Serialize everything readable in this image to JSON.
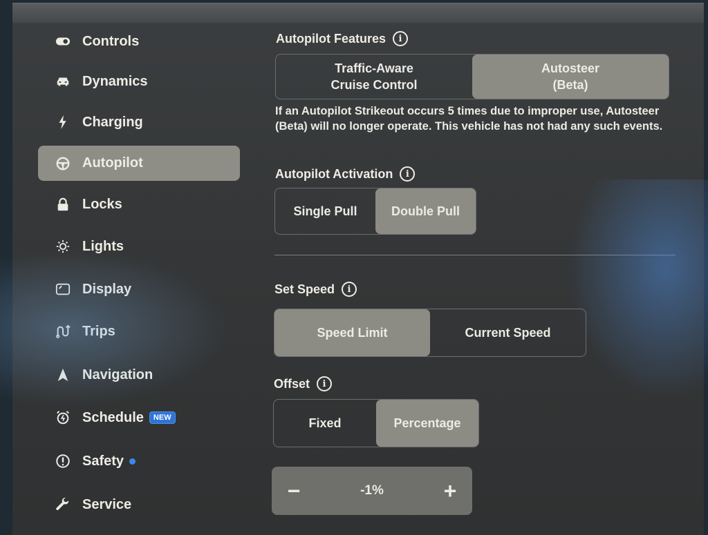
{
  "sidebar": {
    "items": [
      {
        "label": "Controls",
        "icon": "toggle-icon"
      },
      {
        "label": "Dynamics",
        "icon": "car-icon"
      },
      {
        "label": "Charging",
        "icon": "bolt-icon"
      },
      {
        "label": "Autopilot",
        "icon": "steering-wheel-icon",
        "active": true
      },
      {
        "label": "Locks",
        "icon": "lock-icon"
      },
      {
        "label": "Lights",
        "icon": "sun-icon"
      },
      {
        "label": "Display",
        "icon": "display-icon"
      },
      {
        "label": "Trips",
        "icon": "trips-icon"
      },
      {
        "label": "Navigation",
        "icon": "navigation-arrow-icon"
      },
      {
        "label": "Schedule",
        "icon": "alarm-clock-icon",
        "badge": "NEW"
      },
      {
        "label": "Safety",
        "icon": "exclamation-circle-icon",
        "dot": true
      },
      {
        "label": "Service",
        "icon": "wrench-icon"
      }
    ]
  },
  "main": {
    "features": {
      "title": "Autopilot Features",
      "options": [
        "Traffic-Aware\nCruise Control",
        "Autosteer\n(Beta)"
      ],
      "selected": 1,
      "description": "If an Autopilot Strikeout occurs 5 times due to improper use, Autosteer (Beta) will no longer operate. This vehicle has not had any such events."
    },
    "activation": {
      "title": "Autopilot Activation",
      "options": [
        "Single Pull",
        "Double Pull"
      ],
      "selected": 1
    },
    "set_speed": {
      "title": "Set Speed",
      "options": [
        "Speed Limit",
        "Current Speed"
      ],
      "selected": 0
    },
    "offset": {
      "title": "Offset",
      "options": [
        "Fixed",
        "Percentage"
      ],
      "selected": 1,
      "value": "-1%",
      "minus": "−",
      "plus": "+"
    }
  },
  "colors": {
    "badge_blue": "#2f74d8",
    "active_segment": "#8d8c84",
    "background": "#353738"
  }
}
